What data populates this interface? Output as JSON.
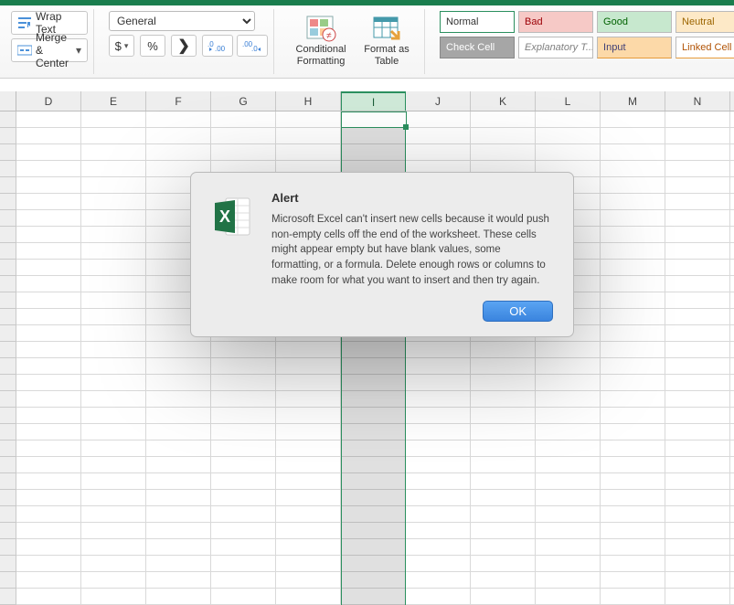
{
  "ribbon": {
    "wrap_text": "Wrap Text",
    "merge_center": "Merge & Center",
    "number_format": "General",
    "currency": "$",
    "percent": "%",
    "comma": ",",
    "dec_inc": ".0←.00",
    "dec_dec": ".00→.0",
    "cond_fmt": "Conditional Formatting",
    "fmt_table": "Format as Table",
    "styles": {
      "normal": "Normal",
      "bad": "Bad",
      "good": "Good",
      "neutral": "Neutral",
      "check": "Check Cell",
      "explan": "Explanatory T...",
      "input": "Input",
      "linked": "Linked Cell"
    }
  },
  "columns": [
    "D",
    "E",
    "F",
    "G",
    "H",
    "I",
    "J",
    "K",
    "L",
    "M",
    "N"
  ],
  "active_column": "I",
  "dialog": {
    "title": "Alert",
    "body": "Microsoft Excel can't insert new cells because it would push non-empty cells off the end of the worksheet. These cells might appear empty but have blank values, some formatting, or a formula. Delete enough rows or columns to make room for what you want to insert and then try again.",
    "ok": "OK"
  }
}
